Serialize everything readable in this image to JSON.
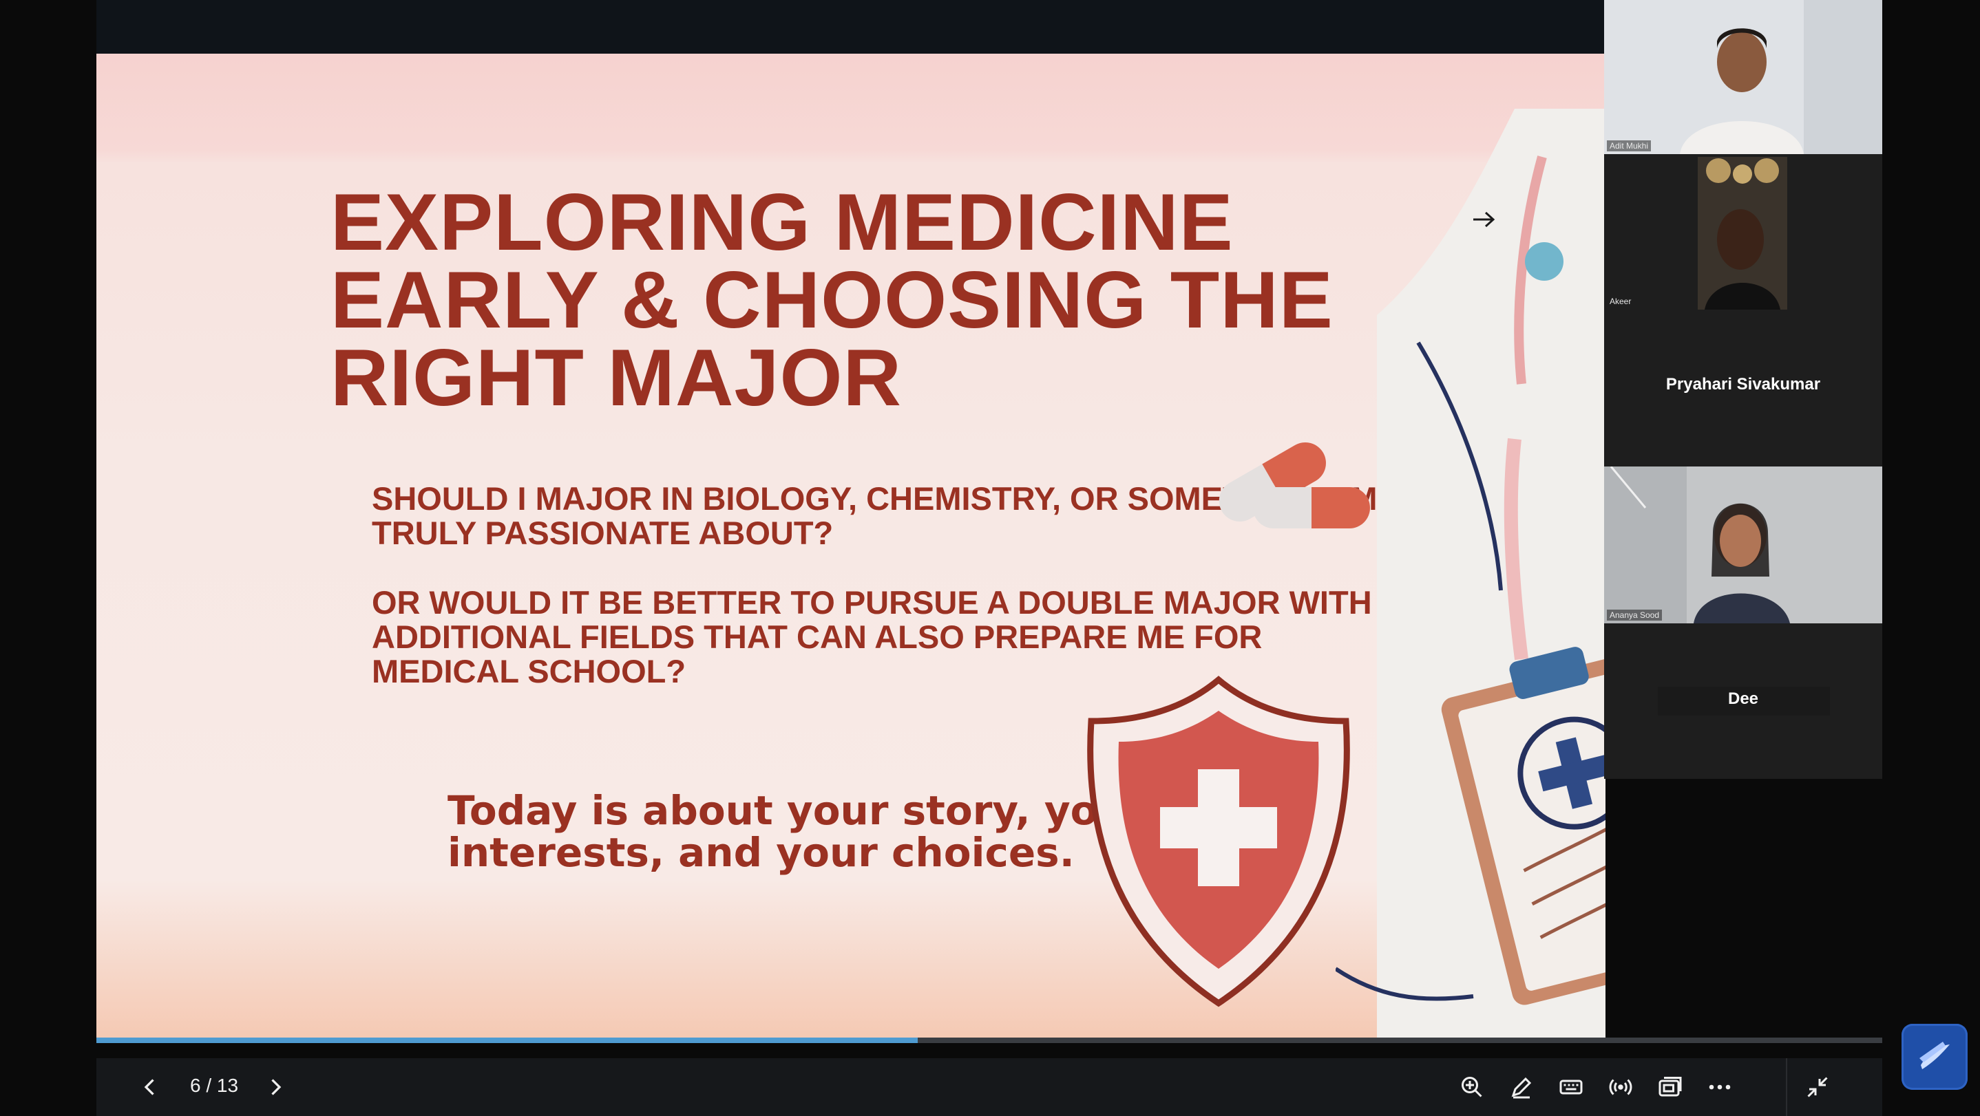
{
  "slide": {
    "title": "EXPLORING MEDICINE EARLY & CHOOSING THE RIGHT MAJOR",
    "question1": "SHOULD I MAJOR IN BIOLOGY, CHEMISTRY, OR SOMETHING I’M TRULY PASSIONATE ABOUT?",
    "question2": "OR WOULD IT BE BETTER TO PURSUE A DOUBLE MAJOR WITH ADDITIONAL FIELDS THAT CAN ALSO PREPARE ME FOR MEDICAL SCHOOL?",
    "tagline": "Today is about your story, your interests, and your choices."
  },
  "participants": [
    {
      "name": "Adit Mukhi",
      "video": true
    },
    {
      "name": "Akeer",
      "video": true
    },
    {
      "name": "Pryahari Sivakumar",
      "video": false
    },
    {
      "name": "Ananya Sood",
      "video": true
    },
    {
      "name": "Dee",
      "video": false
    }
  ],
  "controls": {
    "page_indicator": "6 / 13",
    "progress": 0.46
  },
  "colors": {
    "title": "#9a3122",
    "accent_blue": "#4f9bd1",
    "shield_red": "#d2574f",
    "background": "#0a0a0a"
  },
  "icons": [
    "chevron-left-icon",
    "chevron-right-icon",
    "zoom-in-icon",
    "pen-icon",
    "keyboard-icon",
    "broadcast-icon",
    "picture-in-picture-icon",
    "more-icon",
    "exit-fullscreen-icon",
    "app-logo-icon",
    "cursor-arrow-icon"
  ]
}
